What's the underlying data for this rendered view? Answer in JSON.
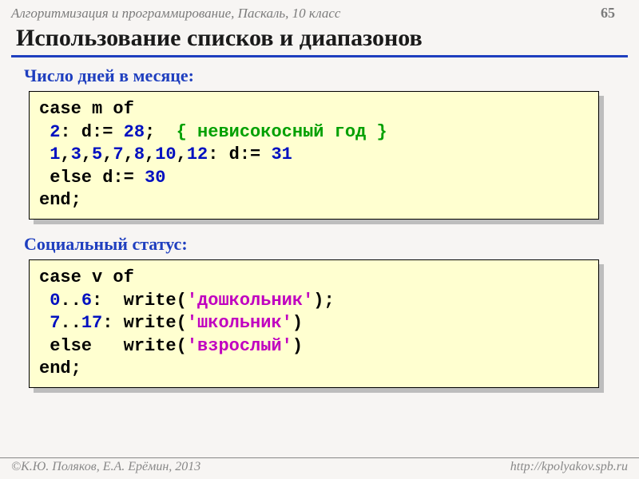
{
  "header": {
    "left": "Алгоритмизация и программирование, Паскаль, 10 класс",
    "page": "65"
  },
  "title": "Использование списков и диапазонов",
  "section1": {
    "label": "Число дней в месяце:",
    "line1_a": "case m of",
    "line2_a": " ",
    "line2_num": "2",
    "line2_b": ": d:= ",
    "line2_num2": "28",
    "line2_c": ";  ",
    "line2_cmt": "{ невисокосный год }",
    "line3_pre": " ",
    "line3_n1": "1",
    "line3_c1": ",",
    "line3_n2": "3",
    "line3_c2": ",",
    "line3_n3": "5",
    "line3_c3": ",",
    "line3_n4": "7",
    "line3_c4": ",",
    "line3_n5": "8",
    "line3_c5": ",",
    "line3_n6": "10",
    "line3_c6": ",",
    "line3_n7": "12",
    "line3_b": ": d:= ",
    "line3_num": "31",
    "line4_a": " else d:= ",
    "line4_num": "30",
    "line5": "end;"
  },
  "section2": {
    "label": "Социальный статус:",
    "line1": "case v of",
    "line2_pre": " ",
    "line2_r1a": "0",
    "line2_dots": "..",
    "line2_r1b": "6",
    "line2_mid": ":  write(",
    "line2_str": "'дошкольник'",
    "line2_end": ");",
    "line3_pre": " ",
    "line3_r1a": "7",
    "line3_dots": "..",
    "line3_r1b": "17",
    "line3_mid": ": write(",
    "line3_str": "'школьник'",
    "line3_end": ")",
    "line4_a": " else   write(",
    "line4_str": "'взрослый'",
    "line4_end": ")",
    "line5": "end;"
  },
  "footer": {
    "left": "©К.Ю. Поляков, Е.А. Ерёмин, 2013",
    "right": "http://kpolyakov.spb.ru"
  }
}
